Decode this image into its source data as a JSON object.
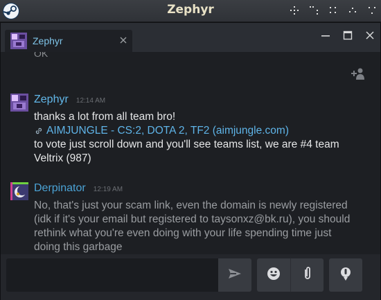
{
  "app": {
    "title": "Zephyr",
    "icons": [
      "steam-logo-icon",
      "move-icon",
      "resize-icon",
      "tile-icon",
      "collapse-icon",
      "expand-icon"
    ]
  },
  "tab": {
    "label": "Zephyr",
    "icons": [
      "avatar-icon",
      "close-icon"
    ]
  },
  "window_controls": [
    "minimize-icon",
    "maximize-icon",
    "close-icon"
  ],
  "chat": {
    "partial_text": "OK",
    "invite_icon": "add-friend-icon",
    "messages": [
      {
        "name": "Zephyr",
        "time": "12:14 AM",
        "lines": {
          "text1": "thanks a lot from all team bro!",
          "link": "AIMJUNGLE - CS:2, DOTA 2, TF2 (aimjungle.com)",
          "text2": "to vote just scroll down and you'll see teams list, we are #4 team Veltrix (987)"
        }
      },
      {
        "name": "Derpinator",
        "time": "12:19 AM",
        "text": "No, that's just your scam link, even the domain is newly registered (idk if it's your email but registered to taysonxz@bk.ru), you should rethink what you're even doing with your life spending time just doing this garbage"
      }
    ]
  },
  "composer": {
    "placeholder": "",
    "buttons": [
      "send-icon",
      "emoji-icon",
      "paperclip-icon",
      "microphone-icon"
    ]
  },
  "colors": {
    "accent": "#62b8ea",
    "title_text": "#e9e2c6",
    "background": "#1d1f23"
  }
}
